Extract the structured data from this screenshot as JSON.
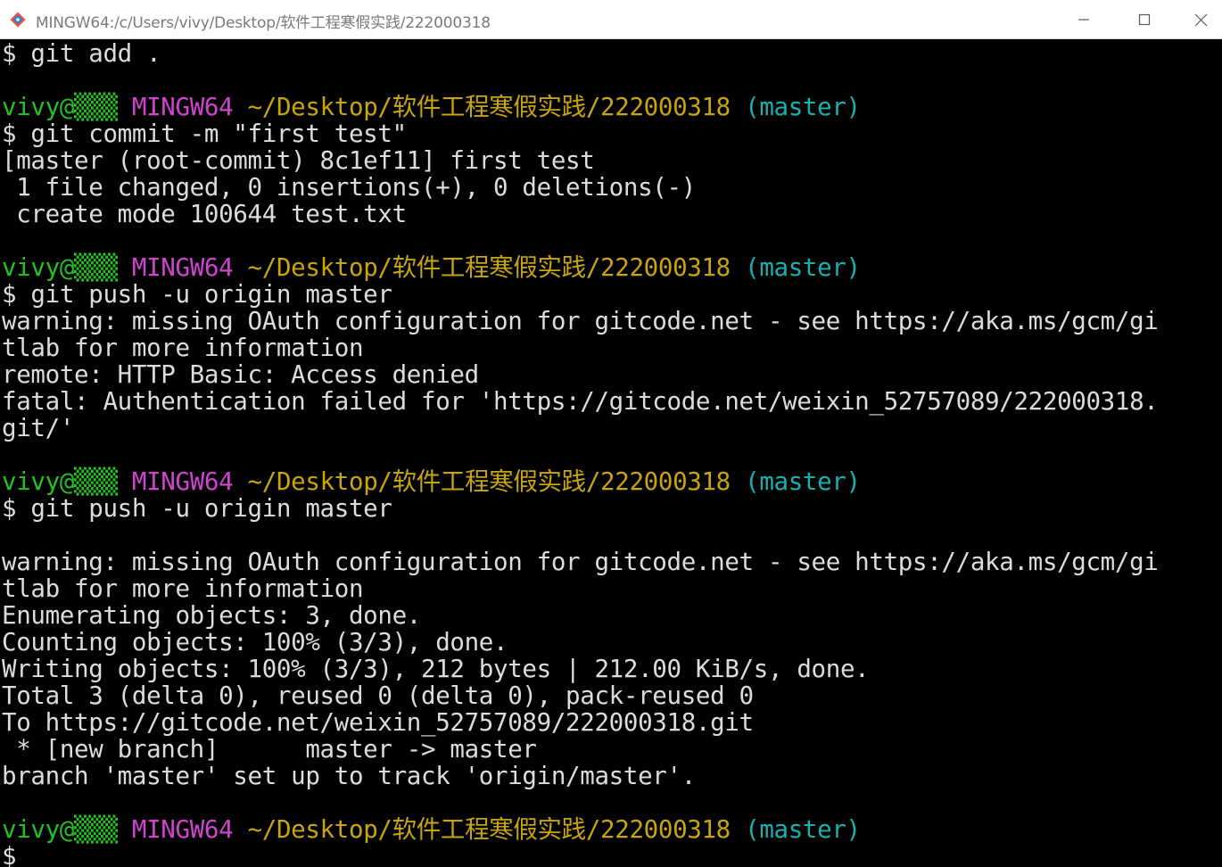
{
  "window": {
    "title": "MINGW64:/c/Users/vivy/Desktop/软件工程寒假实践/222000318",
    "app_icon": "git-bash-icon",
    "controls": {
      "minimize_icon": "minimize-icon",
      "maximize_icon": "maximize-icon",
      "close_icon": "close-icon"
    }
  },
  "colors": {
    "background": "#000000",
    "foreground": "#dcdcdc",
    "user": "#23c123",
    "host": "#cf43cf",
    "path": "#c8a40d",
    "branch": "#19b0b0"
  },
  "prompt": {
    "user": "vivy@",
    "hostmark": "▒▒▒",
    "host": "MINGW64",
    "path": "~/Desktop/软件工程寒假实践/222000318",
    "branch": "(master)"
  },
  "terminal": {
    "lines": [
      "$ git add .",
      "",
      "PROMPT",
      "$ git commit -m \"first test\"",
      "[master (root-commit) 8c1ef11] first test",
      " 1 file changed, 0 insertions(+), 0 deletions(-)",
      " create mode 100644 test.txt",
      "",
      "PROMPT",
      "$ git push -u origin master",
      "warning: missing OAuth configuration for gitcode.net - see https://aka.ms/gcm/gi",
      "tlab for more information",
      "remote: HTTP Basic: Access denied",
      "fatal: Authentication failed for 'https://gitcode.net/weixin_52757089/222000318.",
      "git/'",
      "",
      "PROMPT",
      "$ git push -u origin master",
      "",
      "warning: missing OAuth configuration for gitcode.net - see https://aka.ms/gcm/gi",
      "tlab for more information",
      "Enumerating objects: 3, done.",
      "Counting objects: 100% (3/3), done.",
      "Writing objects: 100% (3/3), 212 bytes | 212.00 KiB/s, done.",
      "Total 3 (delta 0), reused 0 (delta 0), pack-reused 0",
      "To https://gitcode.net/weixin_52757089/222000318.git",
      " * [new branch]      master -> master",
      "branch 'master' set up to track 'origin/master'.",
      "",
      "PROMPT",
      "$"
    ]
  }
}
